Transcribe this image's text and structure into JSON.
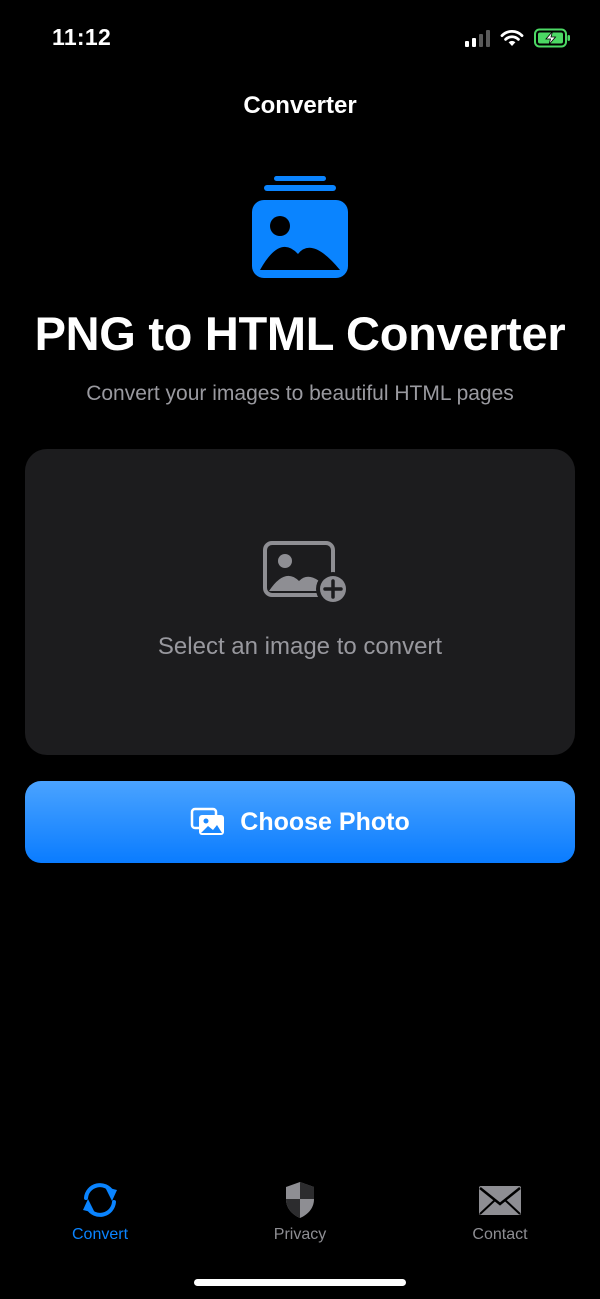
{
  "status_bar": {
    "time": "11:12",
    "icons": [
      "cellular-signal-icon",
      "wifi-icon",
      "battery-charging-icon"
    ]
  },
  "nav": {
    "title": "Converter"
  },
  "hero": {
    "icon": "photo-stack-icon",
    "title": "PNG to HTML Converter",
    "subtitle": "Convert your images to beautiful HTML pages"
  },
  "drop_area": {
    "icon": "photo-badge-plus-icon",
    "placeholder": "Select an image to convert"
  },
  "choose_button": {
    "icon": "photos-icon",
    "label": "Choose Photo"
  },
  "tab_bar": {
    "tabs": [
      {
        "label": "Convert",
        "icon": "arrows-circle-icon",
        "active": true
      },
      {
        "label": "Privacy",
        "icon": "shield-icon",
        "active": false
      },
      {
        "label": "Contact",
        "icon": "envelope-icon",
        "active": false
      }
    ]
  },
  "colors": {
    "background": "#000000",
    "accent": "#0a84ff",
    "card": "#1c1c1e",
    "secondary_text": "#98989e"
  }
}
